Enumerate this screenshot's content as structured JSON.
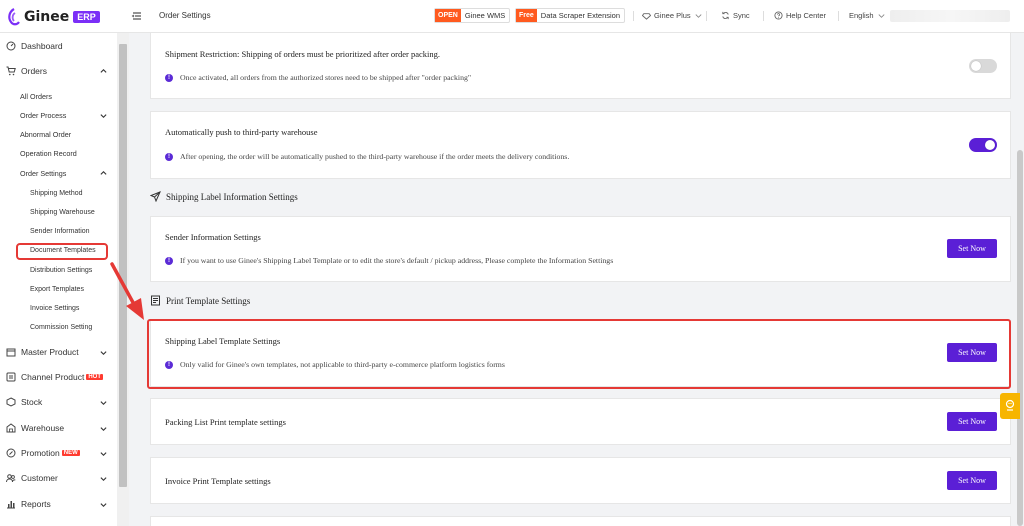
{
  "header": {
    "logo_text": "Ginee",
    "logo_badge": "ERP",
    "page_title": "Order Settings",
    "wms_tag": "OPEN",
    "wms_label": "Ginee WMS",
    "scraper_tag": "Free",
    "scraper_label": "Data Scraper Extension",
    "plus_label": "Ginee Plus",
    "sync_label": "Sync",
    "help_label": "Help Center",
    "language": "English"
  },
  "sidebar": {
    "dashboard": "Dashboard",
    "orders": "Orders",
    "all_orders": "All Orders",
    "order_process": "Order Process",
    "abnormal_order": "Abnormal Order",
    "operation_record": "Operation Record",
    "order_settings": "Order Settings",
    "shipping_method": "Shipping Method",
    "shipping_warehouse": "Shipping Warehouse",
    "sender_information": "Sender Information",
    "document_templates": "Document Templates",
    "distribution_settings": "Distribution Settings",
    "export_templates": "Export Templates",
    "invoice_settings": "Invoice Settings",
    "commission_setting": "Commission Setting",
    "master_product": "Master Product",
    "channel_product": "Channel Product",
    "hot_badge": "HOT",
    "stock": "Stock",
    "warehouse": "Warehouse",
    "promotion": "Promotion",
    "new_badge": "NEW",
    "customer": "Customer",
    "reports": "Reports"
  },
  "main": {
    "shipment_restriction_title": "Shipment Restriction: Shipping of orders must be prioritized after order packing.",
    "shipment_restriction_note": "Once activated, all orders from the authorized stores need to be shipped after \"order packing\"",
    "shipment_restriction_enabled": false,
    "auto_push_title": "Automatically push to third-party warehouse",
    "auto_push_note": "After opening, the order will be automatically pushed to the third-party warehouse if the order meets the delivery conditions.",
    "auto_push_enabled": true,
    "shipping_label_section": "Shipping Label Information Settings",
    "sender_info_title": "Sender Information Settings",
    "sender_info_note": "If you want to use Ginee's Shipping Label Template or to edit the store's default / pickup address, Please complete the Information Settings",
    "print_template_section": "Print Template Settings",
    "shipping_label_template_title": "Shipping Label Template Settings",
    "shipping_label_template_note": "Only valid for Ginee's own templates, not applicable to third-party e-commerce platform logistics forms",
    "packing_list_title": "Packing List Print template settings",
    "invoice_print_title": "Invoice Print Template settings",
    "set_now_label": "Set Now",
    "info_glyph": "!"
  },
  "colors": {
    "brand_purple": "#5b1fd6",
    "highlight_red": "#e53935",
    "badge_orange": "#ff5a1f"
  }
}
